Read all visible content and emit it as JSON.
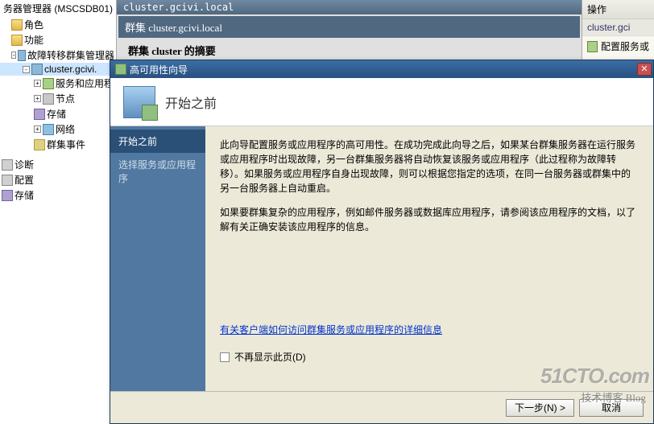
{
  "tree": {
    "root_label": "务器管理器 (MSCSDB01)",
    "items": [
      {
        "label": "角色",
        "cls": "i-folder",
        "indent": 1
      },
      {
        "label": "功能",
        "cls": "i-folder",
        "indent": 1
      },
      {
        "label": "故障转移群集管理器",
        "cls": "i-cluster",
        "indent": 1,
        "expander": "-"
      },
      {
        "label": "cluster.gcivi.",
        "cls": "i-cluster",
        "indent": 2,
        "expander": "-",
        "selected": true
      },
      {
        "label": "服务和应用程",
        "cls": "i-service",
        "indent": 3,
        "expander": "+"
      },
      {
        "label": "节点",
        "cls": "i-node",
        "indent": 3,
        "expander": "+"
      },
      {
        "label": "存储",
        "cls": "i-storage",
        "indent": 3
      },
      {
        "label": "网络",
        "cls": "i-network",
        "indent": 3,
        "expander": "+"
      },
      {
        "label": "群集事件",
        "cls": "i-event",
        "indent": 3
      }
    ],
    "lower": [
      {
        "label": "诊断",
        "cls": "i-config"
      },
      {
        "label": "配置",
        "cls": "i-config"
      },
      {
        "label": "存储",
        "cls": "i-storage"
      }
    ]
  },
  "mid": {
    "titlebar": "cluster.gcivi.local",
    "sub_label": "群集 cluster.gcivi.local",
    "summary": "群集 cluster 的摘要"
  },
  "actions": {
    "header": "操作",
    "sub": "cluster.gci",
    "item1": "配置服务或"
  },
  "wizard": {
    "title": "高可用性向导",
    "header": "开始之前",
    "steps": [
      {
        "label": "开始之前",
        "current": true
      },
      {
        "label": "选择服务或应用程序"
      }
    ],
    "p1": "此向导配置服务或应用程序的高可用性。在成功完成此向导之后，如果某台群集服务器在运行服务或应用程序时出现故障，另一台群集服务器将自动恢复该服务或应用程序（此过程称为故障转移）。如果服务或应用程序自身出现故障，则可以根据您指定的选项，在同一台服务器或群集中的另一台服务器上自动重启。",
    "p2": "如果要群集复杂的应用程序，例如邮件服务器或数据库应用程序，请参阅该应用程序的文档，以了解有关正确安装该应用程序的信息。",
    "link": "有关客户端如何访问群集服务或应用程序的详细信息",
    "checkbox_label": "不再显示此页(D)",
    "buttons": {
      "next": "下一步(N) >",
      "cancel": "取消"
    }
  },
  "watermark": {
    "line1": "51CTO.com",
    "line2": "技术博客 Blog"
  }
}
